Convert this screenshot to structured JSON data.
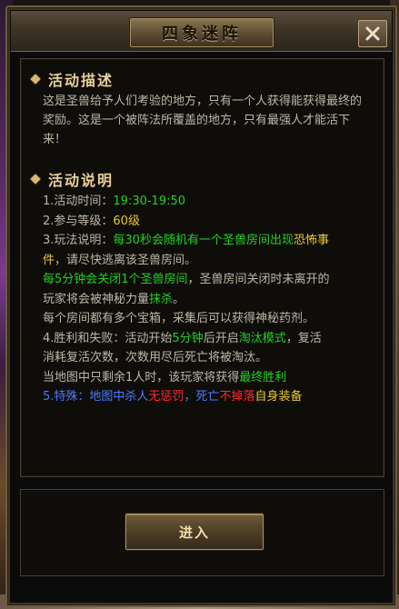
{
  "window": {
    "title": "四象迷阵"
  },
  "description": {
    "heading": "活动描述",
    "text": "这是圣兽给予人们考验的地方，只有一个人获得能获得最终的奖励。这是一个被阵法所覆盖的地方，只有最强人才能活下来！"
  },
  "instructions": {
    "heading": "活动说明",
    "time_label": "1.活动时间：",
    "time_value": "19:30-19:50",
    "level_label": "2.参与等级：",
    "level_value": "60级",
    "rule3_a": "3.玩法说明：",
    "rule3_b": "每30秒会随机有一个圣兽房间出现",
    "rule3_c": "恐怖事",
    "rule3_d": "件",
    "rule3_e": "，请尽快逃离该圣兽房间。",
    "rule3_f": "每5分钟会关闭1个圣兽房间",
    "rule3_g": "，圣兽房间关闭时未离开的",
    "rule3_h": "玩家将会被神秘力量",
    "rule3_i": "抹杀",
    "rule3_j": "。",
    "rule3_k": "每个房间都有多个宝箱，采集后可以获得神秘药剂。",
    "rule4_a": "4.胜利和失败：活动开始",
    "rule4_b": "5分钟",
    "rule4_c": "后开启",
    "rule4_d": "淘汰模式",
    "rule4_e": "，复活",
    "rule4_f": "消耗复活次数，次数用尽后死亡将被淘汰。",
    "rule4_g": "当地图中只剩余1人时，该玩家将获得",
    "rule4_h": "最终胜利",
    "rule5_a": "5.特殊：地图中杀人",
    "rule5_b": "无惩罚",
    "rule5_c": "，死亡",
    "rule5_d": "不掉落",
    "rule5_e": "自身装备"
  },
  "footer": {
    "enter_label": "进入"
  }
}
